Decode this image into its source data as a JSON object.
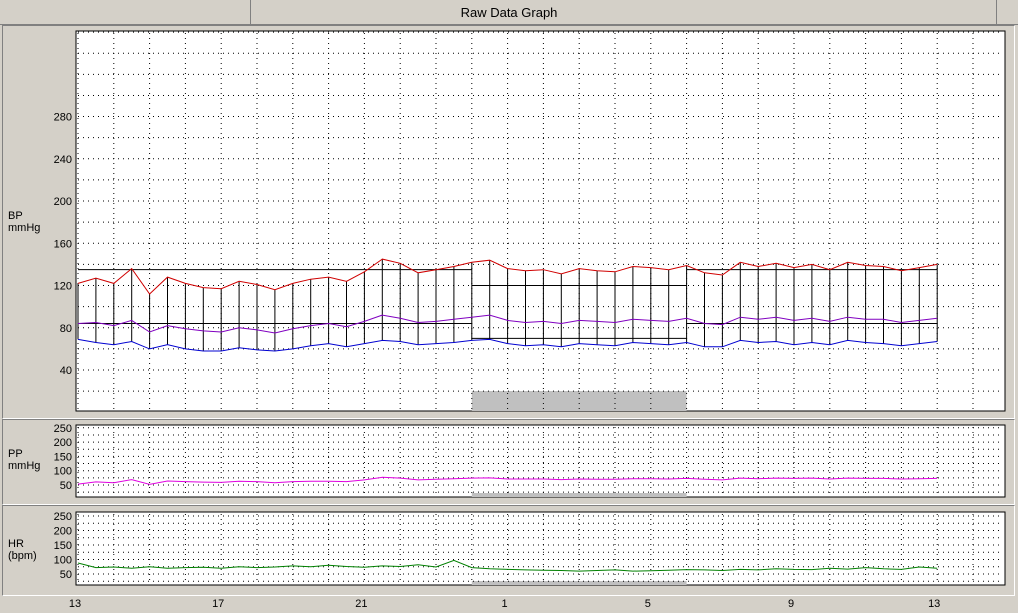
{
  "window": {
    "title": "Raw Data Graph"
  },
  "bp": {
    "label": "BP",
    "unit": "mmHg",
    "yticks": [
      "40",
      "80",
      "120",
      "160",
      "200",
      "240",
      "280"
    ],
    "color_sys": "#d00000",
    "color_map": "#8000c0",
    "color_dia": "#0000d0"
  },
  "pp": {
    "label": "PP",
    "unit": "mmHg",
    "yticks": [
      "50",
      "100",
      "150",
      "200",
      "250"
    ],
    "color": "#e000e0"
  },
  "hr": {
    "label": "HR",
    "unit": "(bpm)",
    "yticks": [
      "50",
      "100",
      "150",
      "200",
      "250"
    ],
    "color": "#008000"
  },
  "xaxis": {
    "ticks": [
      "13",
      "17",
      "21",
      "1",
      "5",
      "9",
      "13"
    ]
  },
  "chart_data": [
    {
      "type": "line",
      "name": "BP",
      "ylim": [
        0,
        360
      ],
      "x_hours": [
        0,
        0.5,
        1,
        1.5,
        2,
        2.5,
        3,
        3.5,
        4,
        4.5,
        5,
        5.5,
        6,
        6.5,
        7,
        7.5,
        8,
        8.5,
        9,
        9.5,
        10,
        10.5,
        11,
        11.5,
        12,
        12.5,
        13,
        13.5,
        14,
        14.5,
        15,
        15.5,
        16,
        16.5,
        17,
        17.5,
        18,
        18.5,
        19,
        19.5,
        20,
        20.5,
        21,
        21.5,
        22,
        22.5,
        23,
        23.5,
        24
      ],
      "series": [
        {
          "name": "systolic",
          "values": [
            122,
            127,
            122,
            136,
            112,
            128,
            122,
            118,
            117,
            124,
            121,
            116,
            122,
            126,
            128,
            124,
            133,
            145,
            141,
            132,
            135,
            138,
            142,
            144,
            136,
            134,
            135,
            131,
            136,
            134,
            133,
            138,
            137,
            135,
            139,
            132,
            130,
            142,
            138,
            141,
            137,
            140,
            135,
            142,
            139,
            138,
            134,
            137,
            140
          ]
        },
        {
          "name": "mean",
          "values": [
            84,
            85,
            82,
            87,
            76,
            82,
            79,
            77,
            76,
            80,
            78,
            75,
            79,
            82,
            84,
            81,
            86,
            92,
            89,
            85,
            86,
            88,
            90,
            92,
            87,
            85,
            86,
            84,
            87,
            86,
            85,
            88,
            87,
            86,
            89,
            84,
            83,
            90,
            88,
            90,
            87,
            89,
            86,
            90,
            88,
            88,
            85,
            87,
            89
          ]
        },
        {
          "name": "diastolic",
          "values": [
            69,
            66,
            64,
            67,
            60,
            64,
            60,
            58,
            58,
            61,
            59,
            58,
            60,
            63,
            65,
            62,
            65,
            68,
            67,
            64,
            65,
            66,
            68,
            69,
            65,
            63,
            64,
            62,
            65,
            64,
            63,
            66,
            65,
            64,
            66,
            62,
            62,
            68,
            66,
            67,
            64,
            66,
            64,
            68,
            66,
            65,
            63,
            65,
            67
          ]
        }
      ],
      "reference_lines": [
        {
          "from_hour": 0,
          "to_hour": 11,
          "systolic": 135,
          "diastolic": 84
        },
        {
          "from_hour": 11,
          "to_hour": 17,
          "systolic": 120,
          "diastolic": 70
        },
        {
          "from_hour": 17,
          "to_hour": 24,
          "systolic": 135,
          "diastolic": 84
        }
      ],
      "shaded_period_hours": [
        11,
        17
      ]
    },
    {
      "type": "line",
      "name": "PP",
      "ylim": [
        0,
        260
      ],
      "x_hours": [
        0,
        0.5,
        1,
        1.5,
        2,
        2.5,
        3,
        3.5,
        4,
        4.5,
        5,
        5.5,
        6,
        6.5,
        7,
        7.5,
        8,
        8.5,
        9,
        9.5,
        10,
        10.5,
        11,
        11.5,
        12,
        12.5,
        13,
        13.5,
        14,
        14.5,
        15,
        15.5,
        16,
        16.5,
        17,
        17.5,
        18,
        18.5,
        19,
        19.5,
        20,
        20.5,
        21,
        21.5,
        22,
        22.5,
        23,
        23.5,
        24
      ],
      "series": [
        {
          "name": "pulse pressure",
          "values": [
            53,
            61,
            58,
            69,
            52,
            64,
            62,
            60,
            59,
            63,
            62,
            58,
            62,
            63,
            63,
            62,
            68,
            77,
            74,
            68,
            70,
            72,
            74,
            75,
            71,
            71,
            71,
            69,
            71,
            70,
            70,
            72,
            72,
            71,
            73,
            70,
            68,
            74,
            72,
            74,
            73,
            74,
            71,
            74,
            73,
            73,
            71,
            72,
            73
          ]
        }
      ],
      "shaded_period_hours": [
        11,
        17
      ]
    },
    {
      "type": "line",
      "name": "HR",
      "ylim": [
        0,
        260
      ],
      "x_hours": [
        0,
        0.5,
        1,
        1.5,
        2,
        2.5,
        3,
        3.5,
        4,
        4.5,
        5,
        5.5,
        6,
        6.5,
        7,
        7.5,
        8,
        8.5,
        9,
        9.5,
        10,
        10.5,
        11,
        11.5,
        12,
        12.5,
        13,
        13.5,
        14,
        14.5,
        15,
        15.5,
        16,
        16.5,
        17,
        17.5,
        18,
        18.5,
        19,
        19.5,
        20,
        20.5,
        21,
        21.5,
        22,
        22.5,
        23,
        23.5,
        24
      ],
      "series": [
        {
          "name": "heart rate",
          "values": [
            88,
            72,
            74,
            70,
            75,
            70,
            72,
            73,
            70,
            75,
            72,
            74,
            78,
            75,
            80,
            76,
            73,
            78,
            76,
            82,
            74,
            97,
            72,
            68,
            66,
            64,
            63,
            62,
            60,
            62,
            64,
            60,
            61,
            63,
            65,
            64,
            62,
            66,
            64,
            68,
            66,
            65,
            70,
            67,
            72,
            68,
            66,
            74,
            70
          ]
        }
      ],
      "shaded_period_hours": [
        11,
        17
      ]
    }
  ]
}
